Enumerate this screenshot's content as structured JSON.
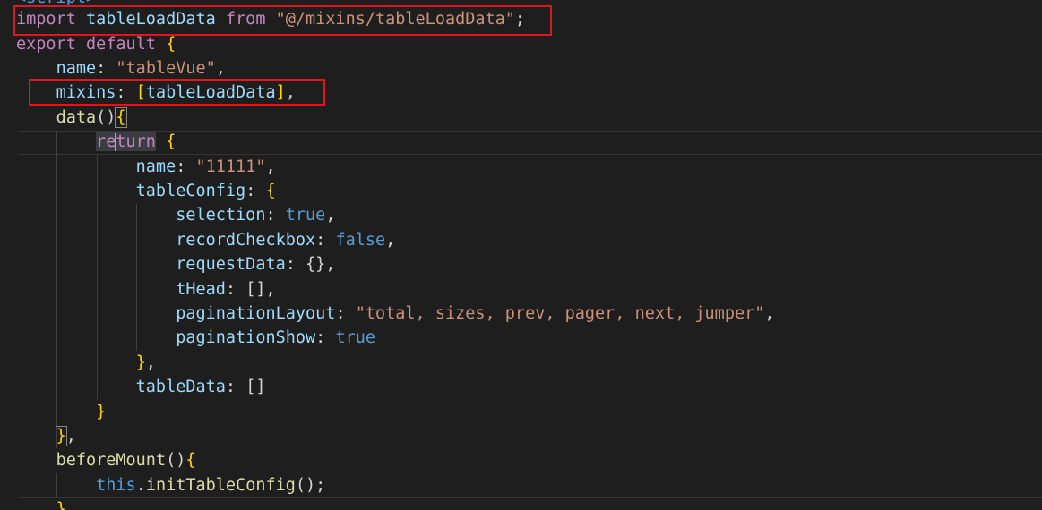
{
  "editor": {
    "colors": {
      "background": "#1e1e1e",
      "keyword_control": "#c586c0",
      "keyword": "#569cd6",
      "variable": "#9cdcfe",
      "function": "#dcdcaa",
      "string": "#ce9178",
      "annotation_box": "#e5141a"
    },
    "lines": {
      "l0": {
        "text": "<script>"
      },
      "l1": {
        "kw_import": "import",
        "ident": "tableLoadData",
        "kw_from": "from",
        "path": "\"@/mixins/tableLoadData\"",
        "end": ";"
      },
      "l2": {
        "kw_export": "export",
        "kw_default": "default",
        "brace": "{"
      },
      "l3": {
        "key": "name",
        "colon": ":",
        "value": "\"tableVue\"",
        "comma": ","
      },
      "l4": {
        "key": "mixins",
        "colon": ":",
        "bracket_open": "[",
        "ident": "tableLoadData",
        "bracket_close": "]",
        "comma": ","
      },
      "l5": {
        "fn": "data",
        "parens": "()",
        "brace": "{"
      },
      "l6": {
        "kw_a": "re",
        "kw_b": "turn",
        "brace": "{"
      },
      "l7": {
        "key": "name",
        "colon": ":",
        "value": "\"11111\"",
        "comma": ","
      },
      "l8": {
        "key": "tableConfig",
        "colon": ":",
        "brace": "{"
      },
      "l9": {
        "key": "selection",
        "colon": ":",
        "value": "true",
        "comma": ","
      },
      "l10": {
        "key": "recordCheckbox",
        "colon": ":",
        "value": "false",
        "comma": ","
      },
      "l11": {
        "key": "requestData",
        "colon": ":",
        "value": "{}",
        "comma": ","
      },
      "l12": {
        "key": "tHead",
        "colon": ":",
        "value": "[]",
        "comma": ","
      },
      "l13": {
        "key": "paginationLayout",
        "colon": ":",
        "value": "\"total, sizes, prev, pager, next, jumper\"",
        "comma": ","
      },
      "l14": {
        "key": "paginationShow",
        "colon": ":",
        "value": "true"
      },
      "l15": {
        "brace": "}",
        "comma": ","
      },
      "l16": {
        "key": "tableData",
        "colon": ":",
        "value": "[]"
      },
      "l17": {
        "brace": "}"
      },
      "l18": {
        "brace": "}",
        "comma": ","
      },
      "l19": {
        "fn": "beforeMount",
        "parens": "()",
        "brace": "{"
      },
      "l20": {
        "kw_this": "this",
        "dot": ".",
        "fn": "initTableConfig",
        "parens": "()",
        "end": ";"
      },
      "l21": {
        "brace": "}",
        "comma": ","
      }
    }
  }
}
